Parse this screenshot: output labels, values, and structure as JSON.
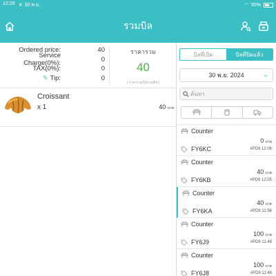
{
  "status_bar": {
    "time": "12:26",
    "date": "ส. 30 พ.ย.",
    "battery": "55%"
  },
  "header": {
    "title": "รวมบิล"
  },
  "summary": {
    "rows": [
      {
        "label": "Ordered price:",
        "value": "40"
      },
      {
        "label": "Service Charge(0%):",
        "value": "0"
      },
      {
        "label": "TAX(0%):",
        "value": "0"
      },
      {
        "label": "Tip:",
        "value": "0"
      }
    ],
    "total_label": "ราคารวม",
    "total_value": "40",
    "total_note": "( ราคารวมไม่รวมทิป )"
  },
  "order_items": [
    {
      "name": "Croissant",
      "qty": "x 1",
      "price": "40",
      "unit": "บาท"
    }
  ],
  "tabs": [
    {
      "label": "บิลที่เปิด",
      "active": false
    },
    {
      "label": "บิลที่ปิดแล้ว",
      "active": true
    }
  ],
  "date_filter": "30 พ.ย. 2024",
  "search": {
    "placeholder": "ค้นหา"
  },
  "filter_icons": [
    "counter-icon",
    "cup-icon",
    "delivery-icon"
  ],
  "bills": [
    {
      "type": "Counter",
      "amount": "0",
      "unit": "บาท",
      "code": "FY6KC",
      "device": "#PD9",
      "time": "12:06",
      "selected": false
    },
    {
      "type": "Counter",
      "amount": "40",
      "unit": "บาท",
      "code": "FY6KB",
      "device": "#PD9",
      "time": "12:05",
      "selected": false
    },
    {
      "type": "Counter",
      "amount": "40",
      "unit": "บาท",
      "code": "FY6KA",
      "device": "#PD9",
      "time": "11:56",
      "selected": true
    },
    {
      "type": "Counter",
      "amount": "100",
      "unit": "บาท",
      "code": "FY6J9",
      "device": "#PD9",
      "time": "11:48",
      "selected": false
    },
    {
      "type": "Counter",
      "amount": "100",
      "unit": "บาท",
      "code": "FY6J8",
      "device": "#PD9",
      "time": "11:46",
      "selected": false
    }
  ],
  "colors": {
    "accent": "#3bbfc4",
    "total": "#4caf50"
  }
}
